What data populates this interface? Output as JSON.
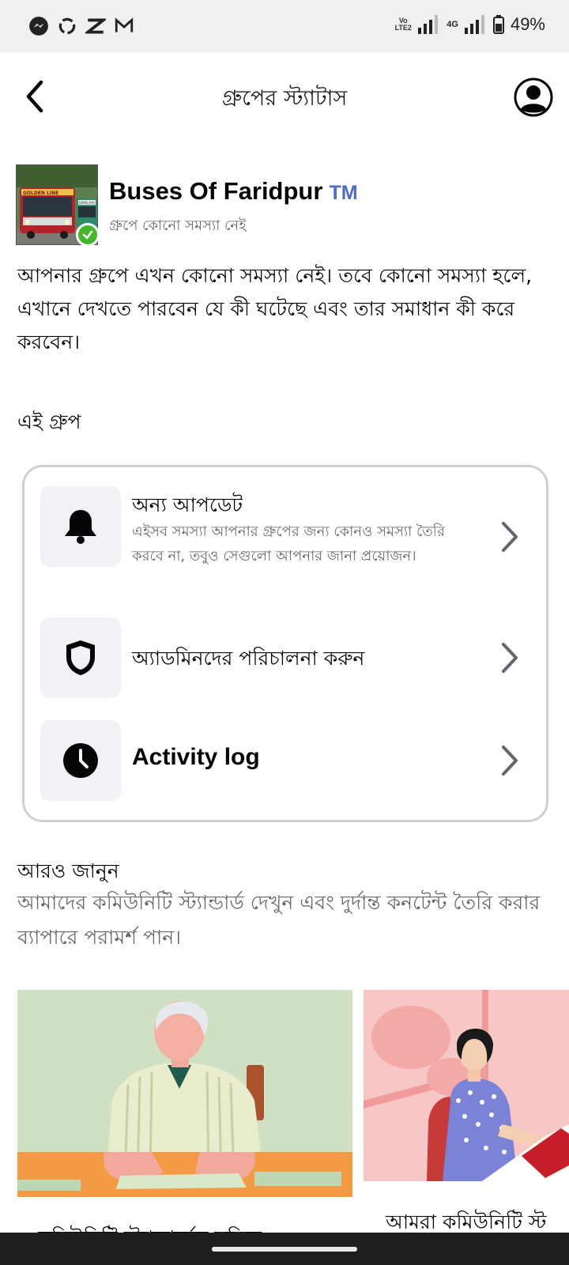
{
  "status_bar": {
    "battery": "49%",
    "network": "4G",
    "volte_label": "Vo\nLTE2",
    "icons": [
      "messenger-icon",
      "sync-icon",
      "capcut-icon",
      "gmail-icon",
      "signal-icon",
      "battery-icon"
    ]
  },
  "header": {
    "title": "গ্রুপের স্ট্যাটাস",
    "back_icon": "chevron-left-icon",
    "profile_icon": "account-circle-icon"
  },
  "group": {
    "name": "Buses Of Faridpur",
    "badge": "TM",
    "status": "গ্রুপে কোনো সমস্যা নেই",
    "thumb_sign_1": "GOLDEN LINE",
    "thumb_sign_2": "HIMALAYA"
  },
  "intro_text": "আপনার গ্রুপে এখন কোনো সমস্যা নেই। তবে কোনো সমস্যা হলে, এখানে দেখতে পারবেন যে কী ঘটেছে এবং তার সমাধান কী করে করবেন।",
  "section_title": "এই গ্রুপ",
  "items": [
    {
      "icon": "bell-icon",
      "title": "অন্য আপডেট",
      "description": "এইসব সমস্যা আপনার গ্রুপের জন্য কোনও সমস্যা তৈরি করবে না, তবুও সেগুলো আপনার জানা প্রয়োজন।"
    },
    {
      "icon": "shield-icon",
      "title": "অ্যাডমিনদের পরিচালনা করুন"
    },
    {
      "icon": "clock-icon",
      "title": "Activity log"
    }
  ],
  "learn_more": {
    "title": "আরও জানুন",
    "description": "আমাদের কমিউনিটি স্ট্যান্ডার্ড দেখুন এবং দুর্দান্ত কনটেন্ট তৈরি করার ব্যাপারে পরামর্শ পান।"
  },
  "articles": [
    {
      "caption": "কমিউনিটি স্ট্যান্ডার্ডের সম্মিক"
    },
    {
      "caption": "আমরা কমিউনিটি স্ট"
    }
  ],
  "colors": {
    "accent_tm": "#4a6cc4",
    "check_green": "#42b72a",
    "secondary_text": "#65676b",
    "card_border": "#ced0d4",
    "icon_bg": "#f0f2f5"
  }
}
